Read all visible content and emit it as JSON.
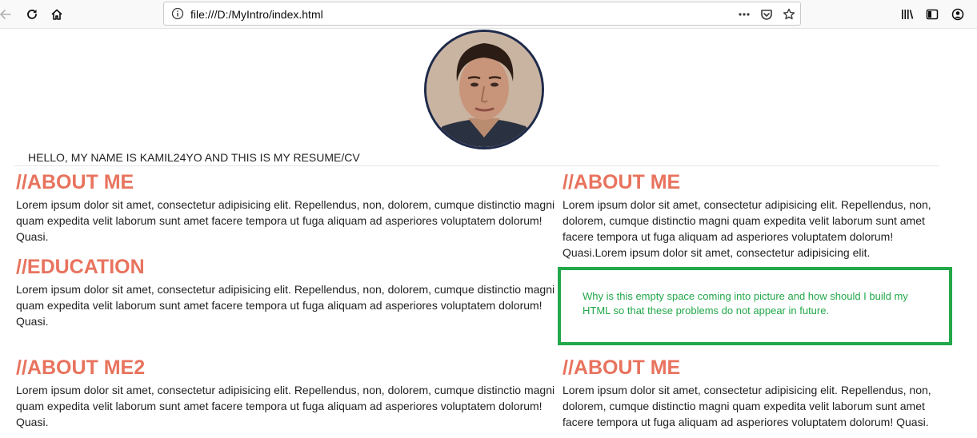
{
  "browser": {
    "url": "file:///D:/MyIntro/index.html"
  },
  "page": {
    "intro": "HELLO, MY NAME IS KAMIL24YO AND THIS IS MY RESUME/CV",
    "left": [
      {
        "heading": "//ABOUT ME",
        "body": "Lorem ipsum dolor sit amet, consectetur adipisicing elit. Repellendus, non, dolorem, cumque distinctio magni quam expedita velit laborum sunt amet facere tempora ut fuga aliquam ad asperiores voluptatem dolorum! Quasi."
      },
      {
        "heading": "//EDUCATION",
        "body": "Lorem ipsum dolor sit amet, consectetur adipisicing elit. Repellendus, non, dolorem, cumque distinctio magni quam expedita velit laborum sunt amet facere tempora ut fuga aliquam ad asperiores voluptatem dolorum! Quasi."
      },
      {
        "heading": "//ABOUT ME2",
        "body": "Lorem ipsum dolor sit amet, consectetur adipisicing elit. Repellendus, non, dolorem, cumque distinctio magni quam expedita velit laborum sunt amet facere tempora ut fuga aliquam ad asperiores voluptatem dolorum! Quasi."
      }
    ],
    "right": [
      {
        "heading": "//ABOUT ME",
        "body": "Lorem ipsum dolor sit amet, consectetur adipisicing elit. Repellendus, non, dolorem, cumque distinctio magni quam expedita velit laborum sunt amet facere tempora ut fuga aliquam ad asperiores voluptatem dolorum! Quasi.Lorem ipsum dolor sit amet, consectetur adipisicing elit."
      },
      {
        "heading": "//ABOUT ME",
        "body": "Lorem ipsum dolor sit amet, consectetur adipisicing elit. Repellendus, non, dolorem, cumque distinctio magni quam expedita velit laborum sunt amet facere tempora ut fuga aliquam ad asperiores voluptatem dolorum! Quasi."
      }
    ]
  },
  "annotation": {
    "text": "Why is this empty space coming into picture and how should I build my HTML so that these problems do not appear in future."
  },
  "colors": {
    "heading": "#e8735e",
    "annotation": "#22a84a",
    "avatar_border": "#1e2a4a"
  },
  "icons": {
    "back": "arrow-left-icon",
    "reload": "reload-icon",
    "home": "home-icon",
    "info": "info-icon",
    "more": "ellipsis-icon",
    "pocket": "pocket-icon",
    "bookmark": "star-icon",
    "library": "library-icon",
    "sidebar": "sidebar-icon",
    "account": "account-icon"
  }
}
